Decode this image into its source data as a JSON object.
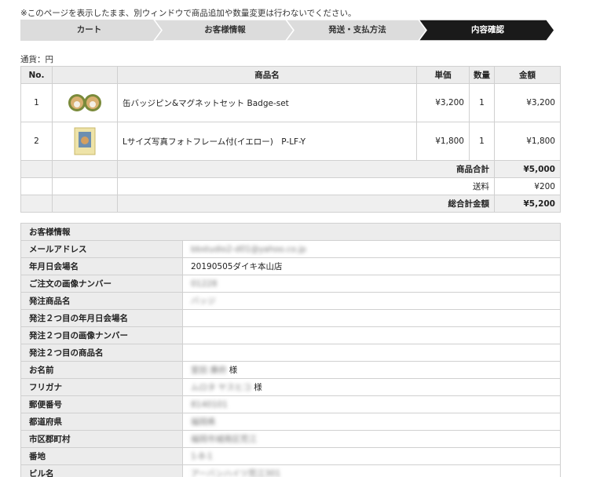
{
  "notice": "※このページを表示したまま、別ウィンドウで商品追加や数量変更は行わないでください。",
  "steps": [
    {
      "label": "カート",
      "active": false
    },
    {
      "label": "お客様情報",
      "active": false
    },
    {
      "label": "発送・支払方法",
      "active": false
    },
    {
      "label": "内容確認",
      "active": true
    }
  ],
  "currency": "通貨：円",
  "order_table": {
    "headers": {
      "no": "No.",
      "image": "",
      "name": "商品名",
      "unit_price": "単価",
      "qty": "数量",
      "amount": "金額"
    },
    "rows": [
      {
        "no": "1",
        "name": "缶バッジピン&マグネットセット Badge-set",
        "unit_price": "¥3,200",
        "qty": "1",
        "amount": "¥3,200",
        "image_icon": "badge-set-thumbnail"
      },
      {
        "no": "2",
        "name": "Lサイズ写真フォトフレーム付(イエロー)　P-LF-Y",
        "unit_price": "¥1,800",
        "qty": "1",
        "amount": "¥1,800",
        "image_icon": "photo-frame-thumbnail"
      }
    ],
    "subtotal_label": "商品合計",
    "subtotal_value": "¥5,000",
    "shipping_label": "送料",
    "shipping_value": "¥200",
    "total_label": "総合計金額",
    "total_value": "¥5,200"
  },
  "customer": {
    "title": "お客様情報",
    "rows": [
      {
        "label": "メールアドレス",
        "value": "bbstudio2-d01@yahoo.co.jp",
        "blurred": true
      },
      {
        "label": "年月日会場名",
        "value": "20190505ダイキ本山店",
        "blurred": false
      },
      {
        "label": "ご注文の画像ナンバー",
        "value": "01228",
        "blurred": true
      },
      {
        "label": "発注商品名",
        "value": "バッジ",
        "blurred": true
      },
      {
        "label": "発注２つ目の年月日会場名",
        "value": "",
        "blurred": false
      },
      {
        "label": "発注２つ目の画像ナンバー",
        "value": "",
        "blurred": false
      },
      {
        "label": "発注２つ目の商品名",
        "value": "",
        "blurred": false
      },
      {
        "label": "お名前",
        "value": "室田 康府",
        "suffix": "様",
        "blurred": true
      },
      {
        "label": "フリガナ",
        "value": "ムロタ ヤスヒコ",
        "suffix": "様",
        "blurred": true
      },
      {
        "label": "郵便番号",
        "value": "8140101",
        "blurred": true
      },
      {
        "label": "都道府県",
        "value": "福岡県",
        "blurred": true
      },
      {
        "label": "市区郡町村",
        "value": "福岡市城南区荒江",
        "blurred": true
      },
      {
        "label": "番地",
        "value": "1-8-1",
        "blurred": true
      },
      {
        "label": "ビル名",
        "value": "アーバンハイツ荒江301",
        "blurred": true
      }
    ]
  },
  "colors": {
    "step_inactive": "#dcdcdc",
    "step_active": "#1a1a1a",
    "header_bg": "#ececec",
    "border": "#d0d0d0"
  }
}
